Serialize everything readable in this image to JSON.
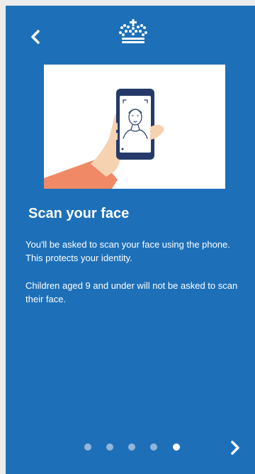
{
  "page": {
    "title": "Scan your face",
    "paragraphs": [
      "You'll be asked to scan your face using the phone. This protects your identity.",
      "Children aged 9 and under will not be asked to scan their face."
    ]
  },
  "icons": {
    "back": "chevron-left-icon",
    "logo": "crown-icon",
    "next": "chevron-right-icon"
  },
  "pagination": {
    "total": 5,
    "current": 5
  },
  "colors": {
    "background": "#1d70b8",
    "illustration_background": "#ffffff",
    "active_dot": "#ffffff",
    "inactive_dot": "#94b5d9",
    "sleeve": "#f08a66",
    "skin": "#f7d2b0",
    "phone": "#253a6a"
  }
}
